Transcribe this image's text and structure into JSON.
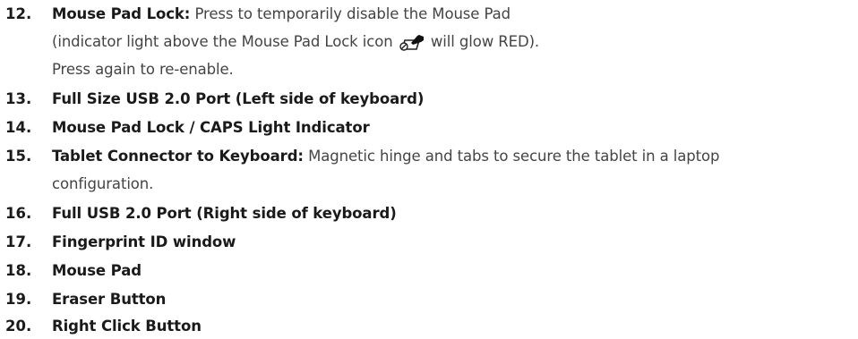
{
  "items": [
    {
      "number": "12.",
      "title": "Mouse Pad Lock:",
      "desc_line1": "Press to temporarily disable the Mouse Pad",
      "desc_line2_a": "(indicator light above the Mouse Pad Lock icon",
      "icon": "mouse-pad-lock-icon",
      "desc_line2_b": "will glow RED).",
      "desc_line3": "Press again to re-enable."
    },
    {
      "number": "13.",
      "title": "Full Size USB 2.0 Port (Left side of keyboard)"
    },
    {
      "number": "14.",
      "title": "Mouse Pad Lock / CAPS Light Indicator"
    },
    {
      "number": "15.",
      "title": "Tablet Connector to Keyboard:",
      "desc_line1": "Magnetic hinge and tabs to secure the tablet in a laptop",
      "desc_line2": "configuration."
    },
    {
      "number": "16.",
      "title": "Full USB 2.0 Port (Right side of keyboard)"
    },
    {
      "number": "17.",
      "title": "Fingerprint ID window"
    },
    {
      "number": "18.",
      "title": "Mouse Pad"
    },
    {
      "number": "19.",
      "title": "Eraser Button"
    },
    {
      "number": "20.",
      "title": "Right Click Button"
    }
  ]
}
